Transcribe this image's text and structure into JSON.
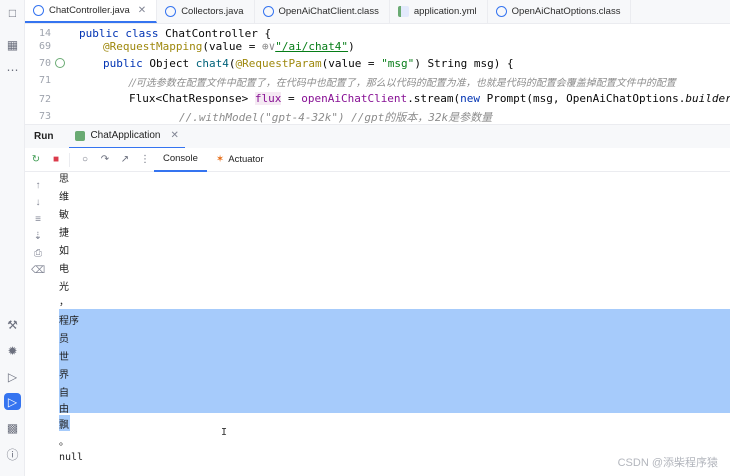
{
  "tabs": [
    {
      "label": "ChatController.java",
      "active": true
    },
    {
      "label": "Collectors.java",
      "active": false
    },
    {
      "label": "OpenAiChatClient.class",
      "active": false
    },
    {
      "label": "application.yml",
      "active": false
    },
    {
      "label": "OpenAiChatOptions.class",
      "active": false
    }
  ],
  "editor": {
    "line_numbers": [
      "14",
      "69",
      "70",
      "71",
      "72",
      "73"
    ],
    "line14": {
      "kw1": "public",
      "kw2": "class",
      "name": " ChatController {"
    },
    "line69": {
      "annotation": "@RequestMapping",
      "open": "(value = ",
      "icon": "⊕∨",
      "path": "\"/ai/chat4\"",
      "close": ")"
    },
    "line70": {
      "kw": "public",
      "type": " Object ",
      "method": "chat4",
      "open": "(",
      "annotation": "@RequestParam",
      "value": "(value = ",
      "str": "\"msg\"",
      "rest": ") String msg) {"
    },
    "line71": {
      "comment": "//可选参数在配置文件中配置了，在代码中也配置了，那么以代码的配置为准，也就是代码的配置会覆盖掉配置文件中的配置"
    },
    "line72": {
      "type": "Flux<ChatResponse> ",
      "var": "flux",
      "eq": " = ",
      "client": "openAiChatClient",
      "call": ".stream(",
      "kw": "new",
      "ctor": " Prompt(msg, OpenAiChatOptions.",
      "builder": "builder",
      "end": "()"
    },
    "line73": {
      "comment": "//.withModel(\"gpt-4-32k\") //gpt的版本，32k是参数量"
    }
  },
  "run_panel": {
    "title": "Run",
    "app_tab": "ChatApplication"
  },
  "console_tabs": [
    {
      "label": "Console",
      "active": true
    },
    {
      "label": "Actuator",
      "active": false
    }
  ],
  "console_output": [
    "思",
    "维",
    "敏",
    "捷",
    "如",
    "电",
    "光",
    "，",
    "程序",
    "员",
    "世",
    "界",
    "自",
    "由",
    "飘",
    "。",
    "null"
  ],
  "caret_glyph": "I",
  "watermark": "CSDN @添柴程序猿",
  "icons": {
    "left_strip": [
      "folder-icon",
      "structure-icon",
      "more-icon",
      "build-icon",
      "debug-icon",
      "services-icon",
      "run-icon",
      "terminal-icon",
      "problems-icon"
    ],
    "toolbar": [
      "rerun-icon",
      "stop-icon",
      "screenshot-icon",
      "restore-layout-icon",
      "export-icon",
      "more-icon"
    ],
    "console_side": [
      "scroll-up-icon",
      "scroll-down-icon",
      "soft-wrap-icon",
      "scroll-to-end-icon",
      "print-icon",
      "clear-icon"
    ]
  },
  "colors": {
    "accent": "#3574f0",
    "selection": "#a6cbfb",
    "keyword": "#0033b3",
    "string": "#067d17",
    "annotation": "#9e880d",
    "comment": "#8c8c8c"
  }
}
